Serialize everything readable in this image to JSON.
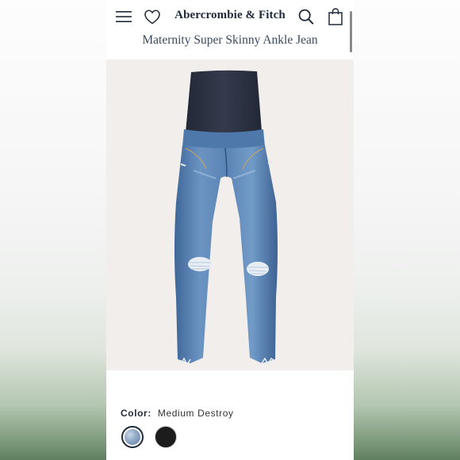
{
  "header": {
    "brand": "Abercrombie & Fitch",
    "product_title": "Maternity Super Skinny Ankle Jean",
    "icons": [
      "menu-icon",
      "heart-icon",
      "search-icon",
      "shopping-bag-icon"
    ]
  },
  "product": {
    "color_label": "Color:",
    "color_value": "Medium Destroy",
    "swatches": [
      {
        "name": "Medium Destroy",
        "color": "#7f9cc0",
        "selected": true
      },
      {
        "name": "Black",
        "color": "#1c1c1c",
        "selected": false
      }
    ]
  },
  "colors": {
    "brand_text": "#1e2a3a",
    "image_background": "#f1eeec",
    "denim": "#5b86b8",
    "waistband": "#2b3142"
  }
}
